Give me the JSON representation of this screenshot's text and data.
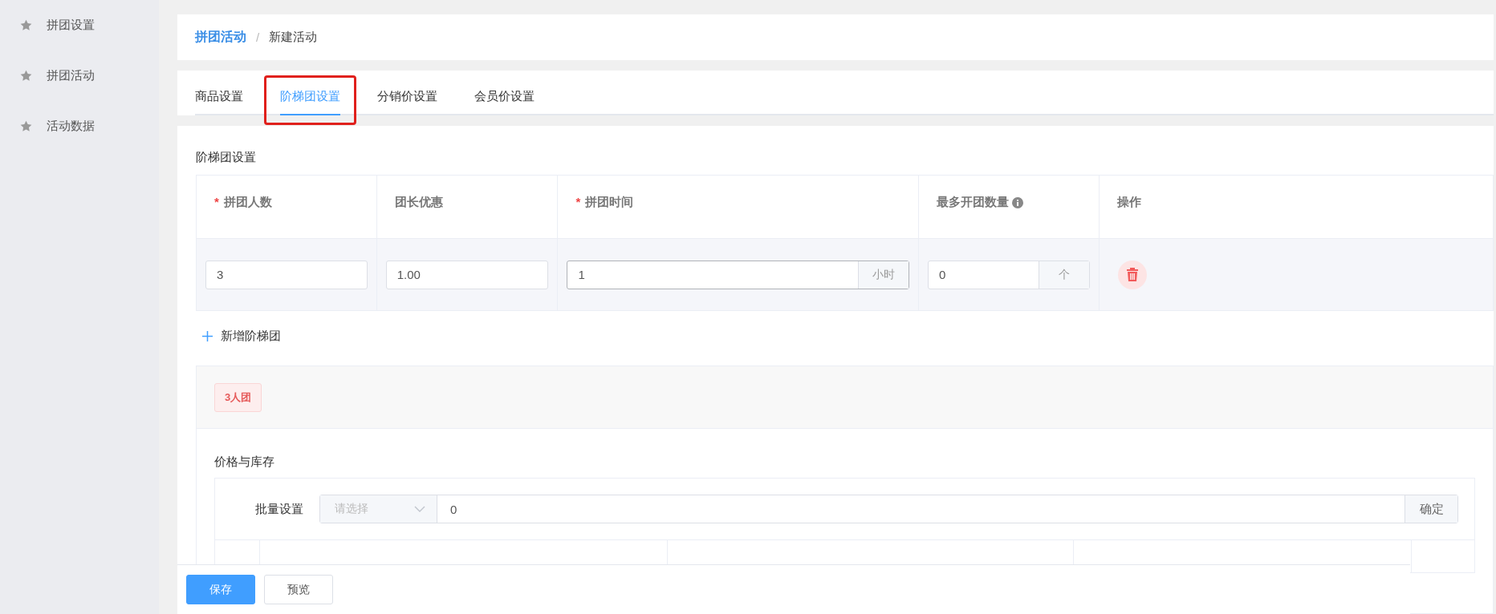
{
  "sidebar": {
    "items": [
      {
        "label": "拼团设置"
      },
      {
        "label": "拼团活动"
      },
      {
        "label": "活动数据"
      }
    ]
  },
  "breadcrumb": {
    "items": [
      {
        "label": "拼团活动",
        "kind": "link"
      },
      {
        "label": "新建活动",
        "kind": "current"
      }
    ],
    "separator": "/"
  },
  "tabs": [
    {
      "label": "商品设置",
      "selected": false,
      "boxed": false
    },
    {
      "label": "阶梯团设置",
      "selected": true,
      "boxed": true
    },
    {
      "label": "分销价设置",
      "selected": false,
      "boxed": false
    },
    {
      "label": "会员价设置",
      "selected": false,
      "boxed": false
    }
  ],
  "tier_section": {
    "title": "阶梯团设置",
    "required_mark": "*",
    "columns": [
      {
        "label": "拼团人数",
        "required": true,
        "info": false
      },
      {
        "label": "团长优惠",
        "required": false,
        "info": false
      },
      {
        "label": "拼团时间",
        "required": true,
        "info": false
      },
      {
        "label": "最多开团数量",
        "required": false,
        "info": true
      },
      {
        "label": "操作",
        "required": false,
        "info": false
      }
    ],
    "rows": [
      {
        "cells": [
          {
            "kind": "input",
            "value": "3",
            "focused": false
          },
          {
            "kind": "input",
            "value": "1.00",
            "focused": false
          },
          {
            "kind": "input",
            "value": "1",
            "suffix": "小时",
            "focused": true
          },
          {
            "kind": "input",
            "value": "0",
            "suffix": "个",
            "focused": false
          },
          {
            "kind": "delete"
          }
        ]
      }
    ],
    "add_label": "新增阶梯团"
  },
  "group": {
    "tag": "3人团",
    "section_title": "价格与库存",
    "batch": {
      "label": "批量设置",
      "select_placeholder": "请选择",
      "value": "0",
      "confirm": "确定"
    }
  },
  "footer": {
    "buttons": [
      {
        "label": "保存",
        "kind": "primary"
      },
      {
        "label": "预览",
        "kind": "default"
      }
    ]
  }
}
